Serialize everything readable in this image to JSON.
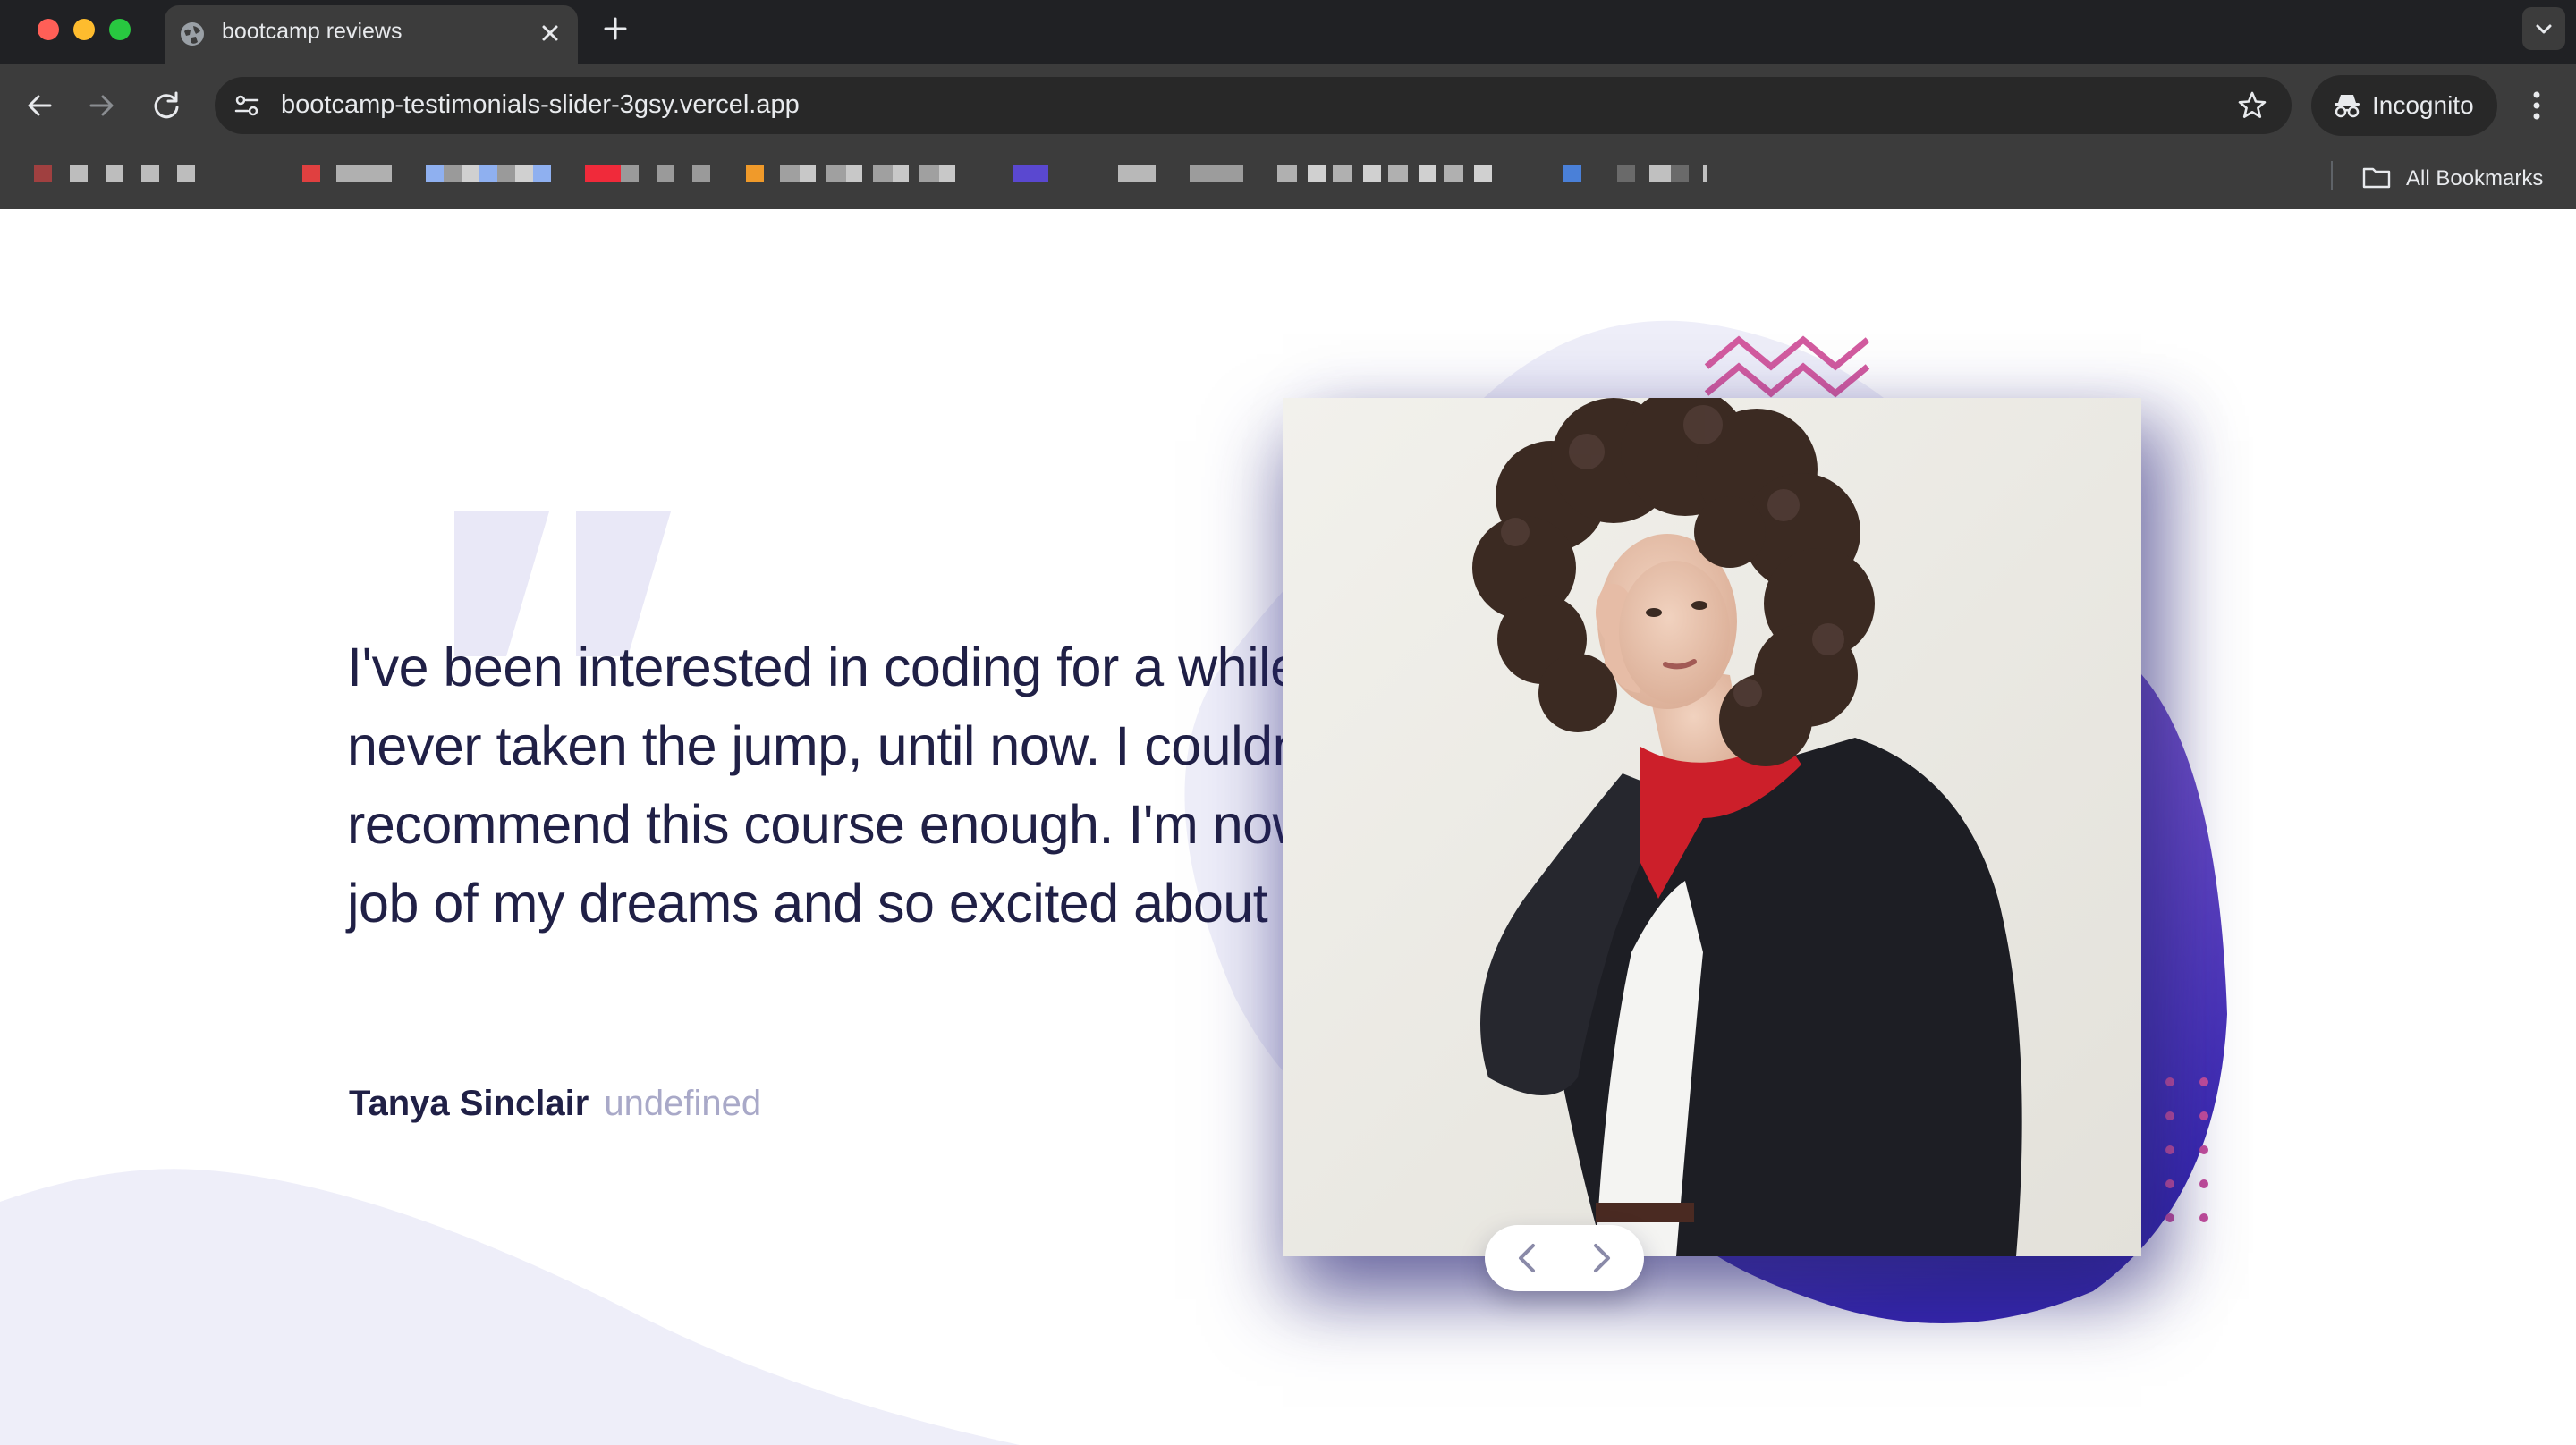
{
  "browser": {
    "tab": {
      "title": "bootcamp reviews",
      "favicon": "globe-icon"
    },
    "url": "bootcamp-testimonials-slider-3gsy.vercel.app",
    "profile_label": "Incognito",
    "bookmarks_label": "All Bookmarks",
    "icons": [
      "back-icon",
      "forward-icon",
      "reload-icon",
      "site-settings-icon",
      "star-icon",
      "incognito-icon",
      "kebab-menu-icon",
      "folder-icon",
      "new-tab-icon",
      "close-icon",
      "chevron-down-icon"
    ]
  },
  "testimonial": {
    "quote": "I've been interested in coding for a while but never taken the jump, until now. I couldn't recommend this course enough. I'm now in the job of my dreams and so excited about the future.",
    "name": "Tanya Sinclair",
    "role": "undefined"
  },
  "controls": {
    "prev": "chevron-left-icon",
    "next": "chevron-right-icon"
  },
  "colors": {
    "dark_blue": "#202046",
    "grayish_blue": "#a9a9c8",
    "purple": "#6b4fc6",
    "deep_purple": "#3b2fb0",
    "light_bg": "#eeeef9",
    "pink_accent": "#d35ca0"
  }
}
